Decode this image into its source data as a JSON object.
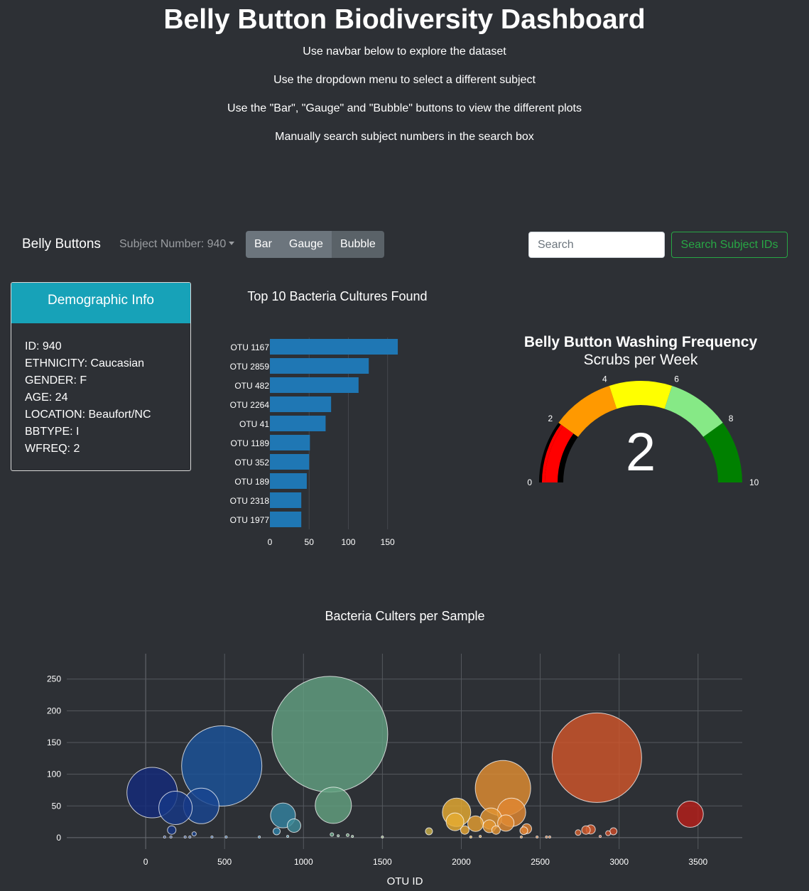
{
  "header": {
    "title": "Belly Button Biodiversity Dashboard",
    "instructions": [
      "Use navbar below to explore the dataset",
      "Use the dropdown menu to select a different subject",
      "Use the \"Bar\", \"Gauge\" and \"Bubble\" buttons to view the different plots",
      "Manually search subject numbers in the search box"
    ]
  },
  "navbar": {
    "brand": "Belly Buttons",
    "subject_dropdown": "Subject Number: 940",
    "buttons": [
      "Bar",
      "Gauge",
      "Bubble"
    ],
    "search_placeholder": "Search",
    "search_button": "Search Subject IDs"
  },
  "demographic": {
    "title": "Demographic Info",
    "rows": [
      "ID: 940",
      "ETHNICITY: Caucasian",
      "GENDER: F",
      "AGE: 24",
      "LOCATION: Beaufort/NC",
      "BBTYPE: I",
      "WFREQ: 2"
    ]
  },
  "chart_data": [
    {
      "type": "bar",
      "orientation": "horizontal",
      "title": "Top 10 Bacteria Cultures Found",
      "color": "#1f77b4",
      "categories": [
        "OTU 1167",
        "OTU 2859",
        "OTU 482",
        "OTU 2264",
        "OTU 41",
        "OTU 1189",
        "OTU 352",
        "OTU 189",
        "OTU 2318",
        "OTU 1977"
      ],
      "values": [
        163,
        126,
        113,
        78,
        71,
        51,
        50,
        47,
        40,
        40
      ],
      "xticks": [
        0,
        50,
        100,
        150
      ],
      "xlim": [
        0,
        172
      ]
    },
    {
      "type": "gauge",
      "title": "Belly Button Washing Frequency",
      "subtitle": "Scrubs per Week",
      "value": 2,
      "value_label": "2",
      "range": [
        0,
        10
      ],
      "ticks": [
        "0",
        "2",
        "4",
        "6",
        "8",
        "10"
      ],
      "steps": [
        {
          "range": [
            0,
            2
          ],
          "color": "#000000"
        },
        {
          "range": [
            2,
            4
          ],
          "color": "#ff9900"
        },
        {
          "range": [
            4,
            6
          ],
          "color": "#ffff00"
        },
        {
          "range": [
            6,
            8
          ],
          "color": "#86e986"
        },
        {
          "range": [
            8,
            10
          ],
          "color": "#008000"
        }
      ],
      "bar_color": "#ff0000"
    },
    {
      "type": "scatter",
      "mode": "bubble",
      "title": "Bacteria Culters per Sample",
      "xlabel": "OTU ID",
      "xticks": [
        0,
        500,
        1000,
        1500,
        2000,
        2500,
        3000,
        3500
      ],
      "yticks": [
        0,
        50,
        100,
        150,
        200,
        250
      ],
      "xlim": [
        -500,
        3780
      ],
      "ylim": [
        -18,
        290
      ],
      "grid": true,
      "colorscale": "Earth",
      "points": [
        {
          "x": 41,
          "y": 71
        },
        {
          "x": 189,
          "y": 47
        },
        {
          "x": 352,
          "y": 50
        },
        {
          "x": 482,
          "y": 113
        },
        {
          "x": 165,
          "y": 12
        },
        {
          "x": 307,
          "y": 6
        },
        {
          "x": 830,
          "y": 10
        },
        {
          "x": 870,
          "y": 35
        },
        {
          "x": 940,
          "y": 19
        },
        {
          "x": 1167,
          "y": 163
        },
        {
          "x": 1189,
          "y": 51
        },
        {
          "x": 1970,
          "y": 40
        },
        {
          "x": 1960,
          "y": 25
        },
        {
          "x": 1795,
          "y": 10
        },
        {
          "x": 2022,
          "y": 12
        },
        {
          "x": 2090,
          "y": 22
        },
        {
          "x": 2188,
          "y": 30
        },
        {
          "x": 2178,
          "y": 18
        },
        {
          "x": 2220,
          "y": 12
        },
        {
          "x": 2264,
          "y": 78
        },
        {
          "x": 2318,
          "y": 40
        },
        {
          "x": 2282,
          "y": 23
        },
        {
          "x": 2414,
          "y": 14
        },
        {
          "x": 2396,
          "y": 11
        },
        {
          "x": 2859,
          "y": 126
        },
        {
          "x": 2740,
          "y": 8
        },
        {
          "x": 2790,
          "y": 12
        },
        {
          "x": 2820,
          "y": 13
        },
        {
          "x": 2930,
          "y": 7
        },
        {
          "x": 2964,
          "y": 10
        },
        {
          "x": 3450,
          "y": 37
        },
        {
          "x": 120,
          "y": 1
        },
        {
          "x": 160,
          "y": 1
        },
        {
          "x": 250,
          "y": 1
        },
        {
          "x": 280,
          "y": 1
        },
        {
          "x": 420,
          "y": 1
        },
        {
          "x": 510,
          "y": 1
        },
        {
          "x": 720,
          "y": 1
        },
        {
          "x": 900,
          "y": 2
        },
        {
          "x": 1180,
          "y": 5
        },
        {
          "x": 1220,
          "y": 3
        },
        {
          "x": 1280,
          "y": 4
        },
        {
          "x": 1310,
          "y": 2
        },
        {
          "x": 1500,
          "y": 1
        },
        {
          "x": 2060,
          "y": 1
        },
        {
          "x": 2120,
          "y": 2
        },
        {
          "x": 2380,
          "y": 1
        },
        {
          "x": 2480,
          "y": 1
        },
        {
          "x": 2540,
          "y": 1
        },
        {
          "x": 2560,
          "y": 1
        },
        {
          "x": 2880,
          "y": 2
        }
      ]
    }
  ]
}
